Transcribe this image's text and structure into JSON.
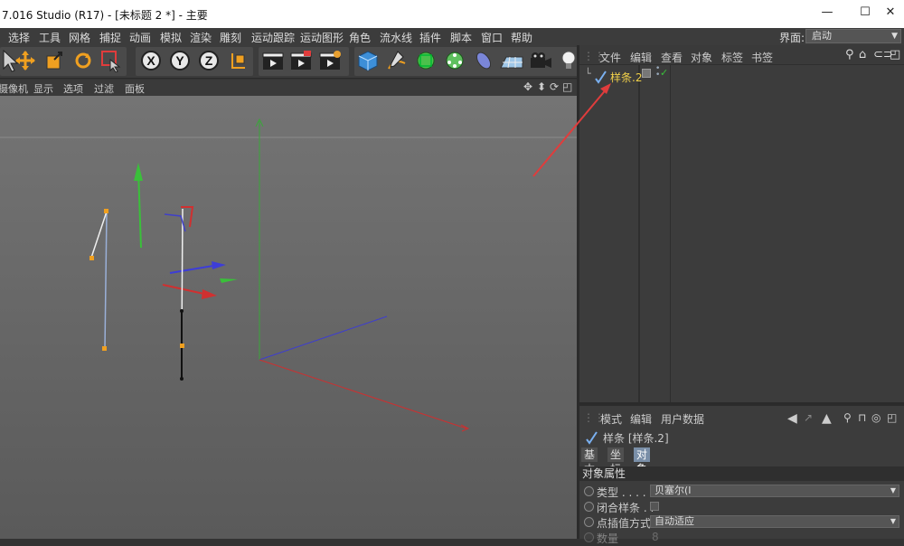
{
  "window": {
    "title": "7.016 Studio (R17) - [未标题 2 *] - 主要",
    "minimize": "—",
    "maximize": "☐",
    "close": "✕"
  },
  "menubar": {
    "items": [
      "选择",
      "工具",
      "网格",
      "捕捉",
      "动画",
      "模拟",
      "渲染",
      "雕刻",
      "运动跟踪",
      "运动图形",
      "角色",
      "流水线",
      "插件",
      "脚本",
      "窗口",
      "帮助"
    ],
    "layout_label": "界面:",
    "layout_value": "启动"
  },
  "toolbar": {
    "axis_x": "X",
    "axis_y": "Y",
    "axis_z": "Z"
  },
  "viewport": {
    "menu": [
      "摄像机",
      "显示",
      "选项",
      "过滤",
      "面板"
    ],
    "nav_icons": [
      "move-view-icon",
      "dolly-view-icon",
      "rotate-view-icon",
      "maximize-view-icon"
    ]
  },
  "object_manager": {
    "menu": [
      "文件",
      "编辑",
      "查看",
      "对象",
      "标签",
      "书签"
    ],
    "objects": [
      {
        "name": "样条.2",
        "icon": "spline-icon",
        "visible": true,
        "enabled": true
      }
    ]
  },
  "attribute_manager": {
    "menu": [
      "模式",
      "编辑",
      "用户数据"
    ],
    "object_title": "样条 [样条.2]",
    "tabs": [
      "基本",
      "坐标",
      "对象"
    ],
    "active_tab": "对象",
    "section": "对象属性",
    "fields": {
      "type_label": "类型 . . . . . .",
      "type_value": "贝塞尔(I",
      "close_label": "闭合样条 . .",
      "interp_label": "点插值方式",
      "interp_value": "自动适应",
      "count_label": "数量",
      "count_value": "8"
    }
  },
  "colors": {
    "accent_red": "#e03c3c",
    "selected_name": "#f2d14a",
    "active_tab": "#7a8fa8"
  }
}
